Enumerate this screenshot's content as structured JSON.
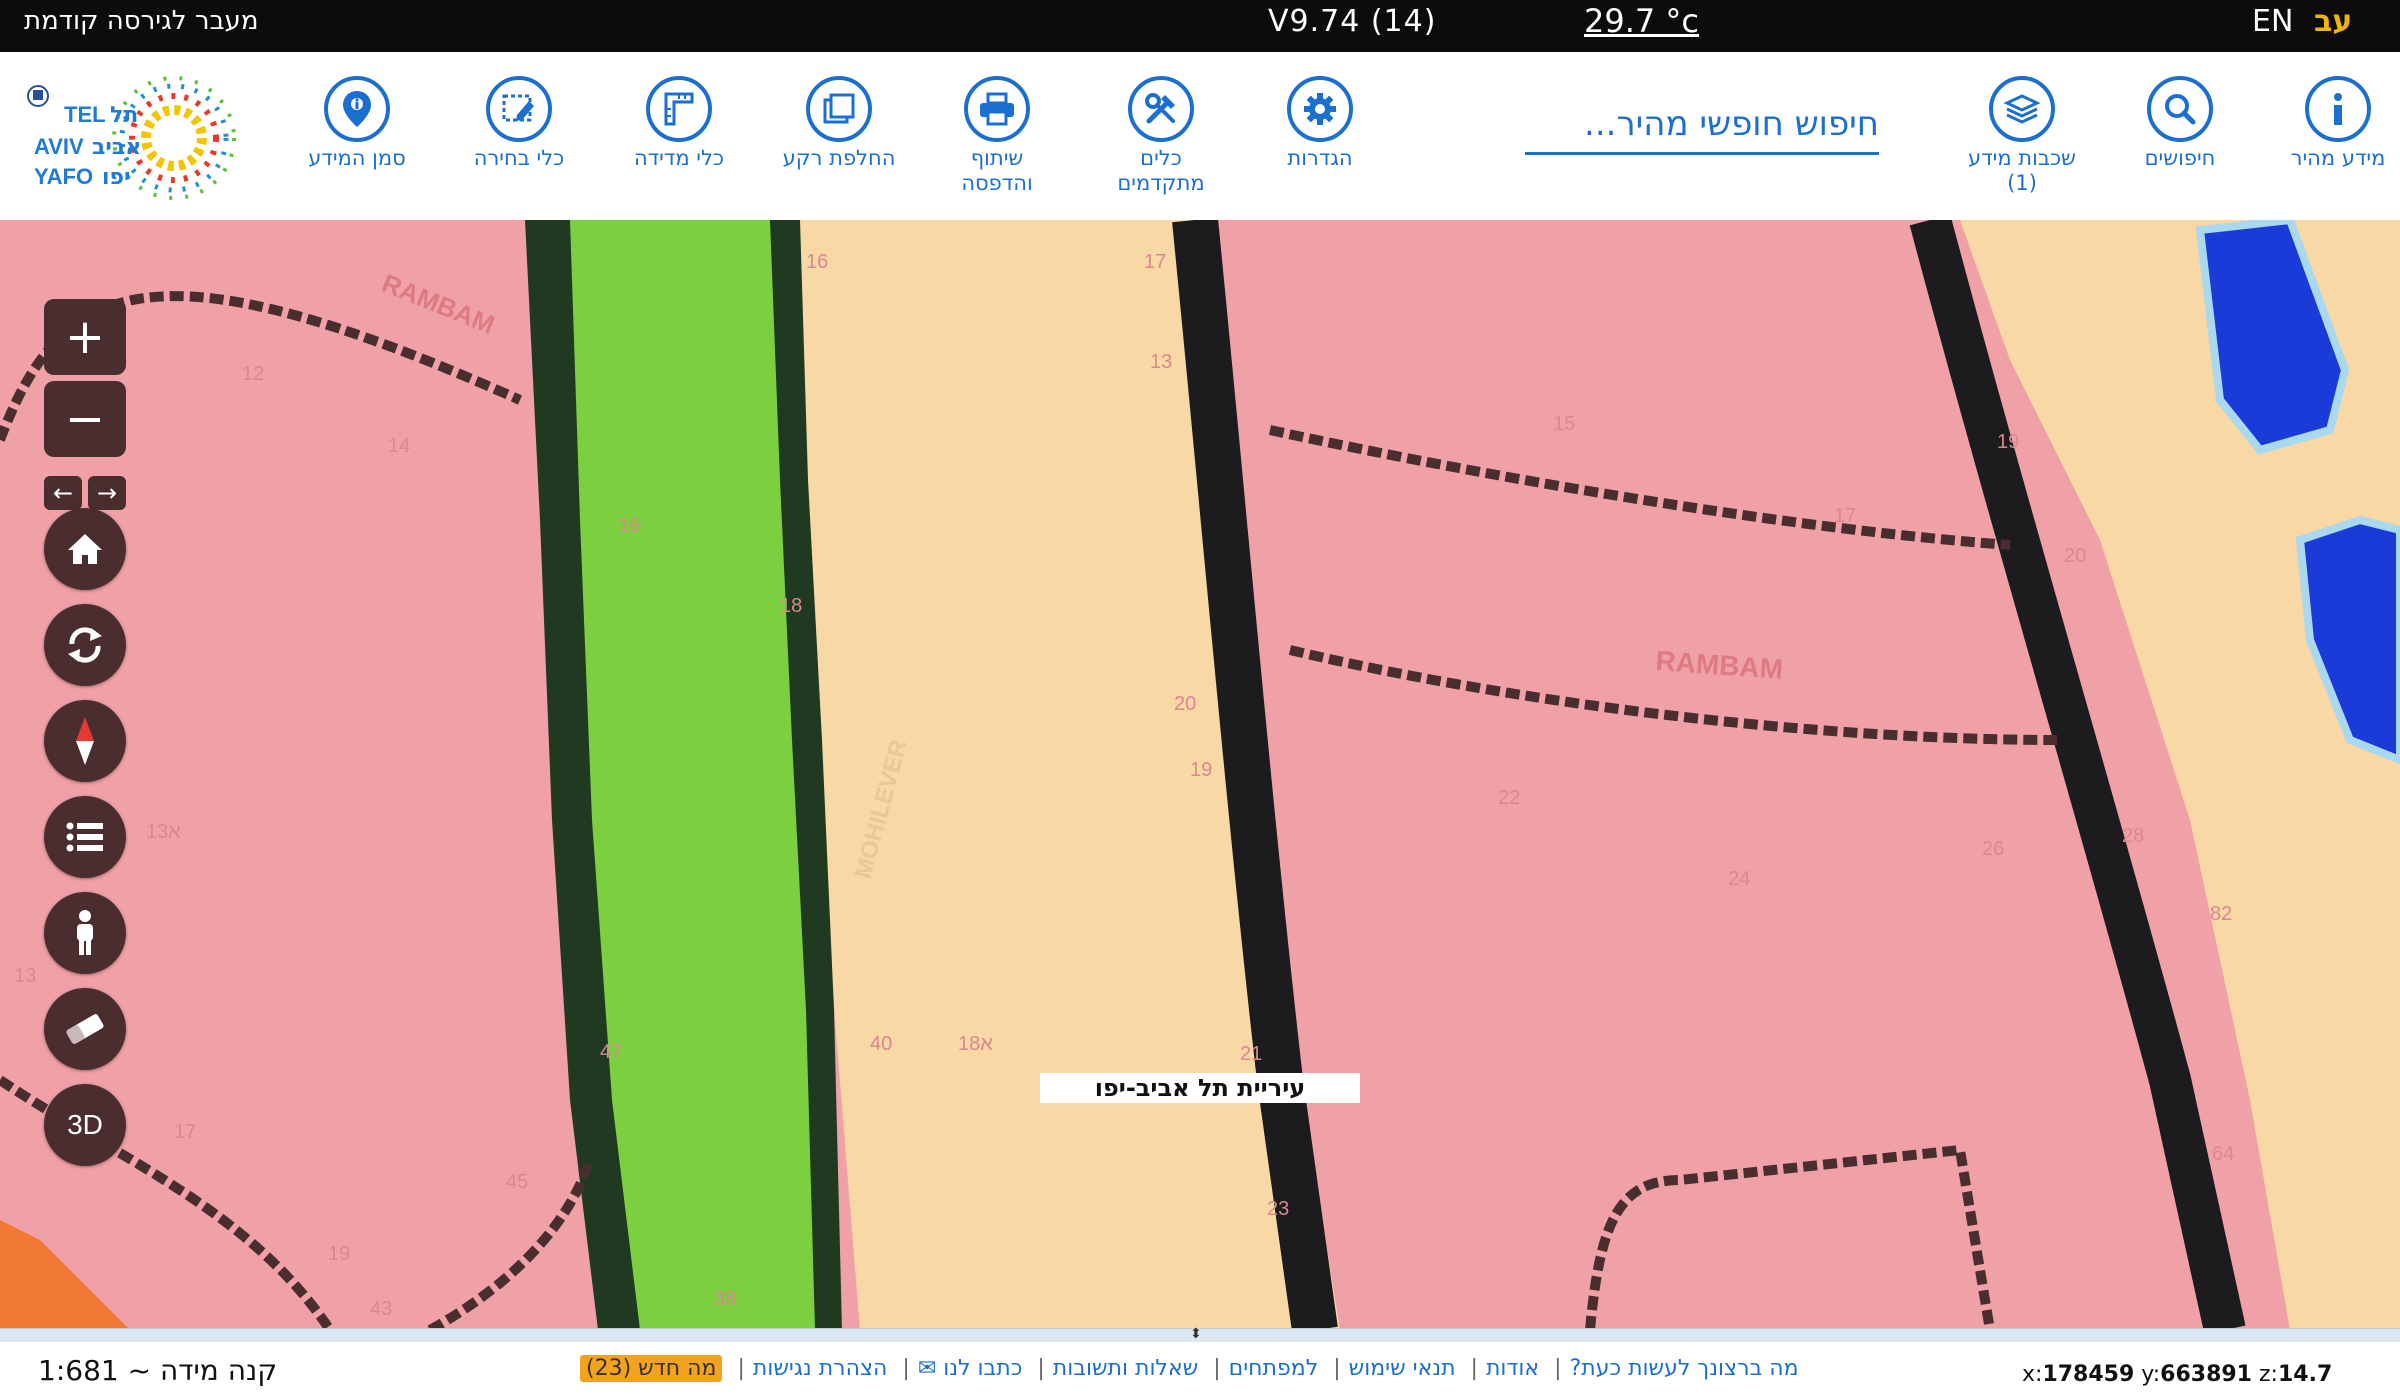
{
  "topbar": {
    "previous_version": "מעבר לגירסה קודמת",
    "version": "V9.74 (14)",
    "temperature": "29.7 °c",
    "lang_en": "EN",
    "lang_he": "עב"
  },
  "logo": {
    "tel": "TEL",
    "aviv": "AVIV",
    "yafo": "YAFO",
    "he_tel": "תל",
    "he_aviv": "אביב",
    "he_yafo": "יפו"
  },
  "toolbar": {
    "quick_info": "מידע מהיר",
    "searches": "חיפושים",
    "layers_line1": "שכבות מידע",
    "layers_line2": "(1)",
    "search_placeholder": "חיפוש חופשי מהיר...",
    "settings": "הגדרות",
    "advanced_line1": "כלים",
    "advanced_line2": "מתקדמים",
    "share_line1": "שיתוף",
    "share_line2": "והדפסה",
    "basemap": "החלפת רקע",
    "measure": "כלי מדידה",
    "select": "כלי בחירה",
    "marker": "סמן המידע"
  },
  "map": {
    "city_label": "עיריית תל אביב-יפו",
    "street_labels": [
      "RAMBAM",
      "RAMBAM",
      "MOHILEVER"
    ],
    "house_numbers": [
      "12",
      "14",
      "16",
      "18",
      "19",
      "20",
      "21",
      "22",
      "23",
      "24",
      "26",
      "28",
      "13א",
      "13",
      "17",
      "19",
      "43",
      "45",
      "47",
      "40",
      "18א",
      "38",
      "16",
      "17",
      "13",
      "15",
      "17",
      "19",
      "20",
      "82",
      "64"
    ],
    "colors": {
      "residential": "#f0a1a7",
      "yellow": "#f8d8a4",
      "green": "#7ccf3f",
      "road": "#1c1c1e",
      "water": "#1a3bd8",
      "orange": "#f07a35"
    },
    "controls": {
      "zoom_in": "+",
      "zoom_out": "−",
      "three_d": "3D"
    }
  },
  "footer": {
    "scale": "קנה מידה ~ 1:681",
    "links": [
      "מה ברצונך לעשות כעת?",
      "אודות",
      "תנאי שימוש",
      "למפתחים",
      "שאלות ותשובות",
      "כתבו לנו ✉",
      "הצהרת נגישות"
    ],
    "whats_new": "מה חדש (23)",
    "coord_x_label": "x:",
    "coord_x": "178459",
    "coord_y_label": "y:",
    "coord_y": "663891",
    "coord_z_label": "z:",
    "coord_z": "14.7"
  }
}
